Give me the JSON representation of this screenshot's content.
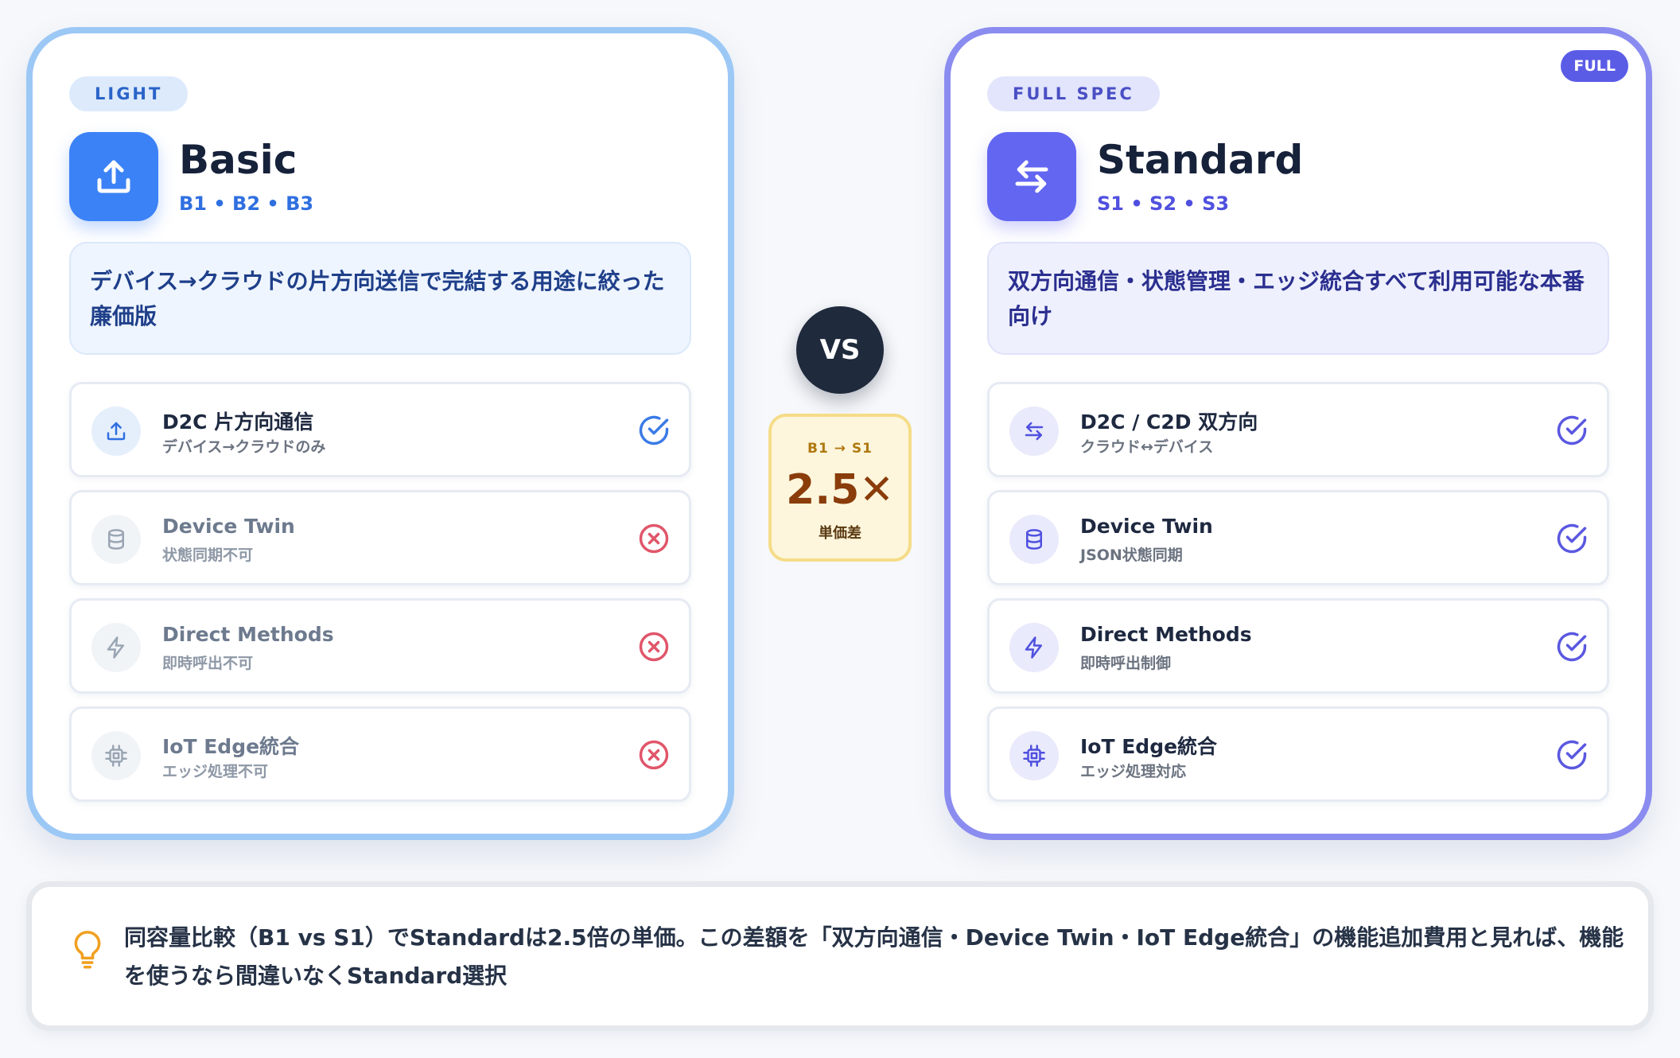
{
  "basic": {
    "tag": "LIGHT",
    "name": "Basic",
    "tiers": "B1 • B2 • B3",
    "icon": "upload-icon",
    "description": "デバイス→クラウドの片方向送信で完結する用途に絞った廉価版",
    "accent": "#3b82f6",
    "features": [
      {
        "title": "D2C 片方向通信",
        "sub": "デバイス→クラウドのみ",
        "icon": "upload-icon",
        "status": "available"
      },
      {
        "title": "Device Twin",
        "sub": "状態同期不可",
        "icon": "database-icon",
        "status": "unavailable"
      },
      {
        "title": "Direct Methods",
        "sub": "即時呼出不可",
        "icon": "lightning-icon",
        "status": "unavailable"
      },
      {
        "title": "IoT Edge統合",
        "sub": "エッジ処理不可",
        "icon": "chip-icon",
        "status": "unavailable"
      }
    ]
  },
  "standard": {
    "tag": "FULL SPEC",
    "badge": "FULL",
    "name": "Standard",
    "tiers": "S1 • S2 • S3",
    "icon": "bidirectional-arrows-icon",
    "description": "双方向通信・状態管理・エッジ統合すべて利用可能な本番向け",
    "accent": "#6366f1",
    "features": [
      {
        "title": "D2C / C2D 双方向",
        "sub": "クラウド↔デバイス",
        "icon": "bidirectional-arrows-icon",
        "status": "available"
      },
      {
        "title": "Device Twin",
        "sub": "JSON状態同期",
        "icon": "database-icon",
        "status": "available"
      },
      {
        "title": "Direct Methods",
        "sub": "即時呼出制御",
        "icon": "lightning-icon",
        "status": "available"
      },
      {
        "title": "IoT Edge統合",
        "sub": "エッジ処理対応",
        "icon": "chip-icon",
        "status": "available"
      }
    ]
  },
  "versus": {
    "label": "VS",
    "ratio_from": "B1 → S1",
    "ratio_value": "2.5✕",
    "ratio_label": "単価差"
  },
  "note": {
    "icon": "lightbulb-icon",
    "text": "同容量比較（B1 vs S1）でStandardは2.5倍の単価。この差額を「双方向通信・Device Twin・IoT Edge統合」の機能追加費用と見れば、機能を使うなら間違いなくStandard選択"
  }
}
